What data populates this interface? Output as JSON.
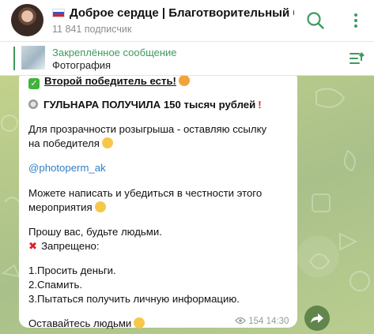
{
  "header": {
    "title": "Доброе сердце | Благотворительный б...",
    "subscribers": "11 841 подписчик"
  },
  "pinned": {
    "title": "Закреплённое сообщение",
    "subtitle": "Фотография"
  },
  "message": {
    "line1": "Второй победитель есть!",
    "line2": "ГУЛЬНАРА ПОЛУЧИЛА 150 тысяч рублей",
    "line3": "Для прозрачности розыгрыша - оставляю ссылку",
    "line4": "на победителя",
    "link": "@photoperm_ak",
    "line5": "Можете написать и убедиться в честности этого",
    "line6": "мероприятия",
    "line7": "Прошу вас, будьте людьми.",
    "line8": "Запрещено:",
    "rule1": "1.Просить деньги.",
    "rule2": "2.Спамить.",
    "rule3": "3.Пытаться получить личную информацию.",
    "closing": "Оставайтесь людьми",
    "views": "154",
    "time": "14:30"
  },
  "icons": {
    "search": "search-icon",
    "pinned_list": "pinned-list-icon",
    "share": "share-arrow-icon",
    "views": "eye-icon",
    "flag": "russia-flag-icon"
  },
  "colors": {
    "accent_green": "#3d9a5e",
    "link_blue": "#2f7ec7",
    "chat_bg": "#b6c88d"
  }
}
